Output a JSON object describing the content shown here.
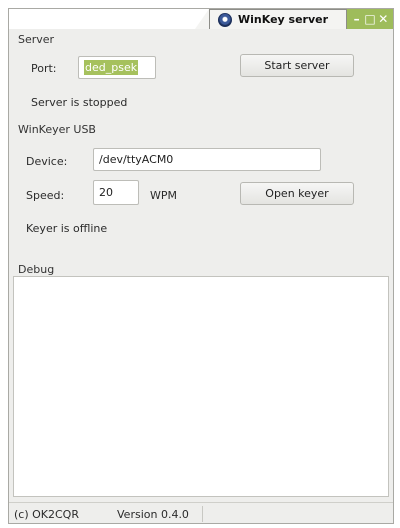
{
  "window": {
    "title": "WinKey server",
    "controls": {
      "minimize": "–",
      "maximize": "□",
      "close": "✕"
    },
    "accent": "#9ebc5b"
  },
  "server": {
    "section_label": "Server",
    "port_label": "Port:",
    "port_value": "ded_psek",
    "start_button": "Start server",
    "status": "Server is stopped"
  },
  "usb": {
    "section_label": "WinKeyer USB",
    "device_label": "Device:",
    "device_value": "/dev/ttyACM0",
    "speed_label": "Speed:",
    "speed_value": "20",
    "speed_unit": "WPM",
    "open_button": "Open keyer",
    "status": "Keyer is offline"
  },
  "debug": {
    "section_label": "Debug"
  },
  "statusbar": {
    "copyright": "(c) OK2CQR",
    "version": "Version 0.4.0"
  }
}
